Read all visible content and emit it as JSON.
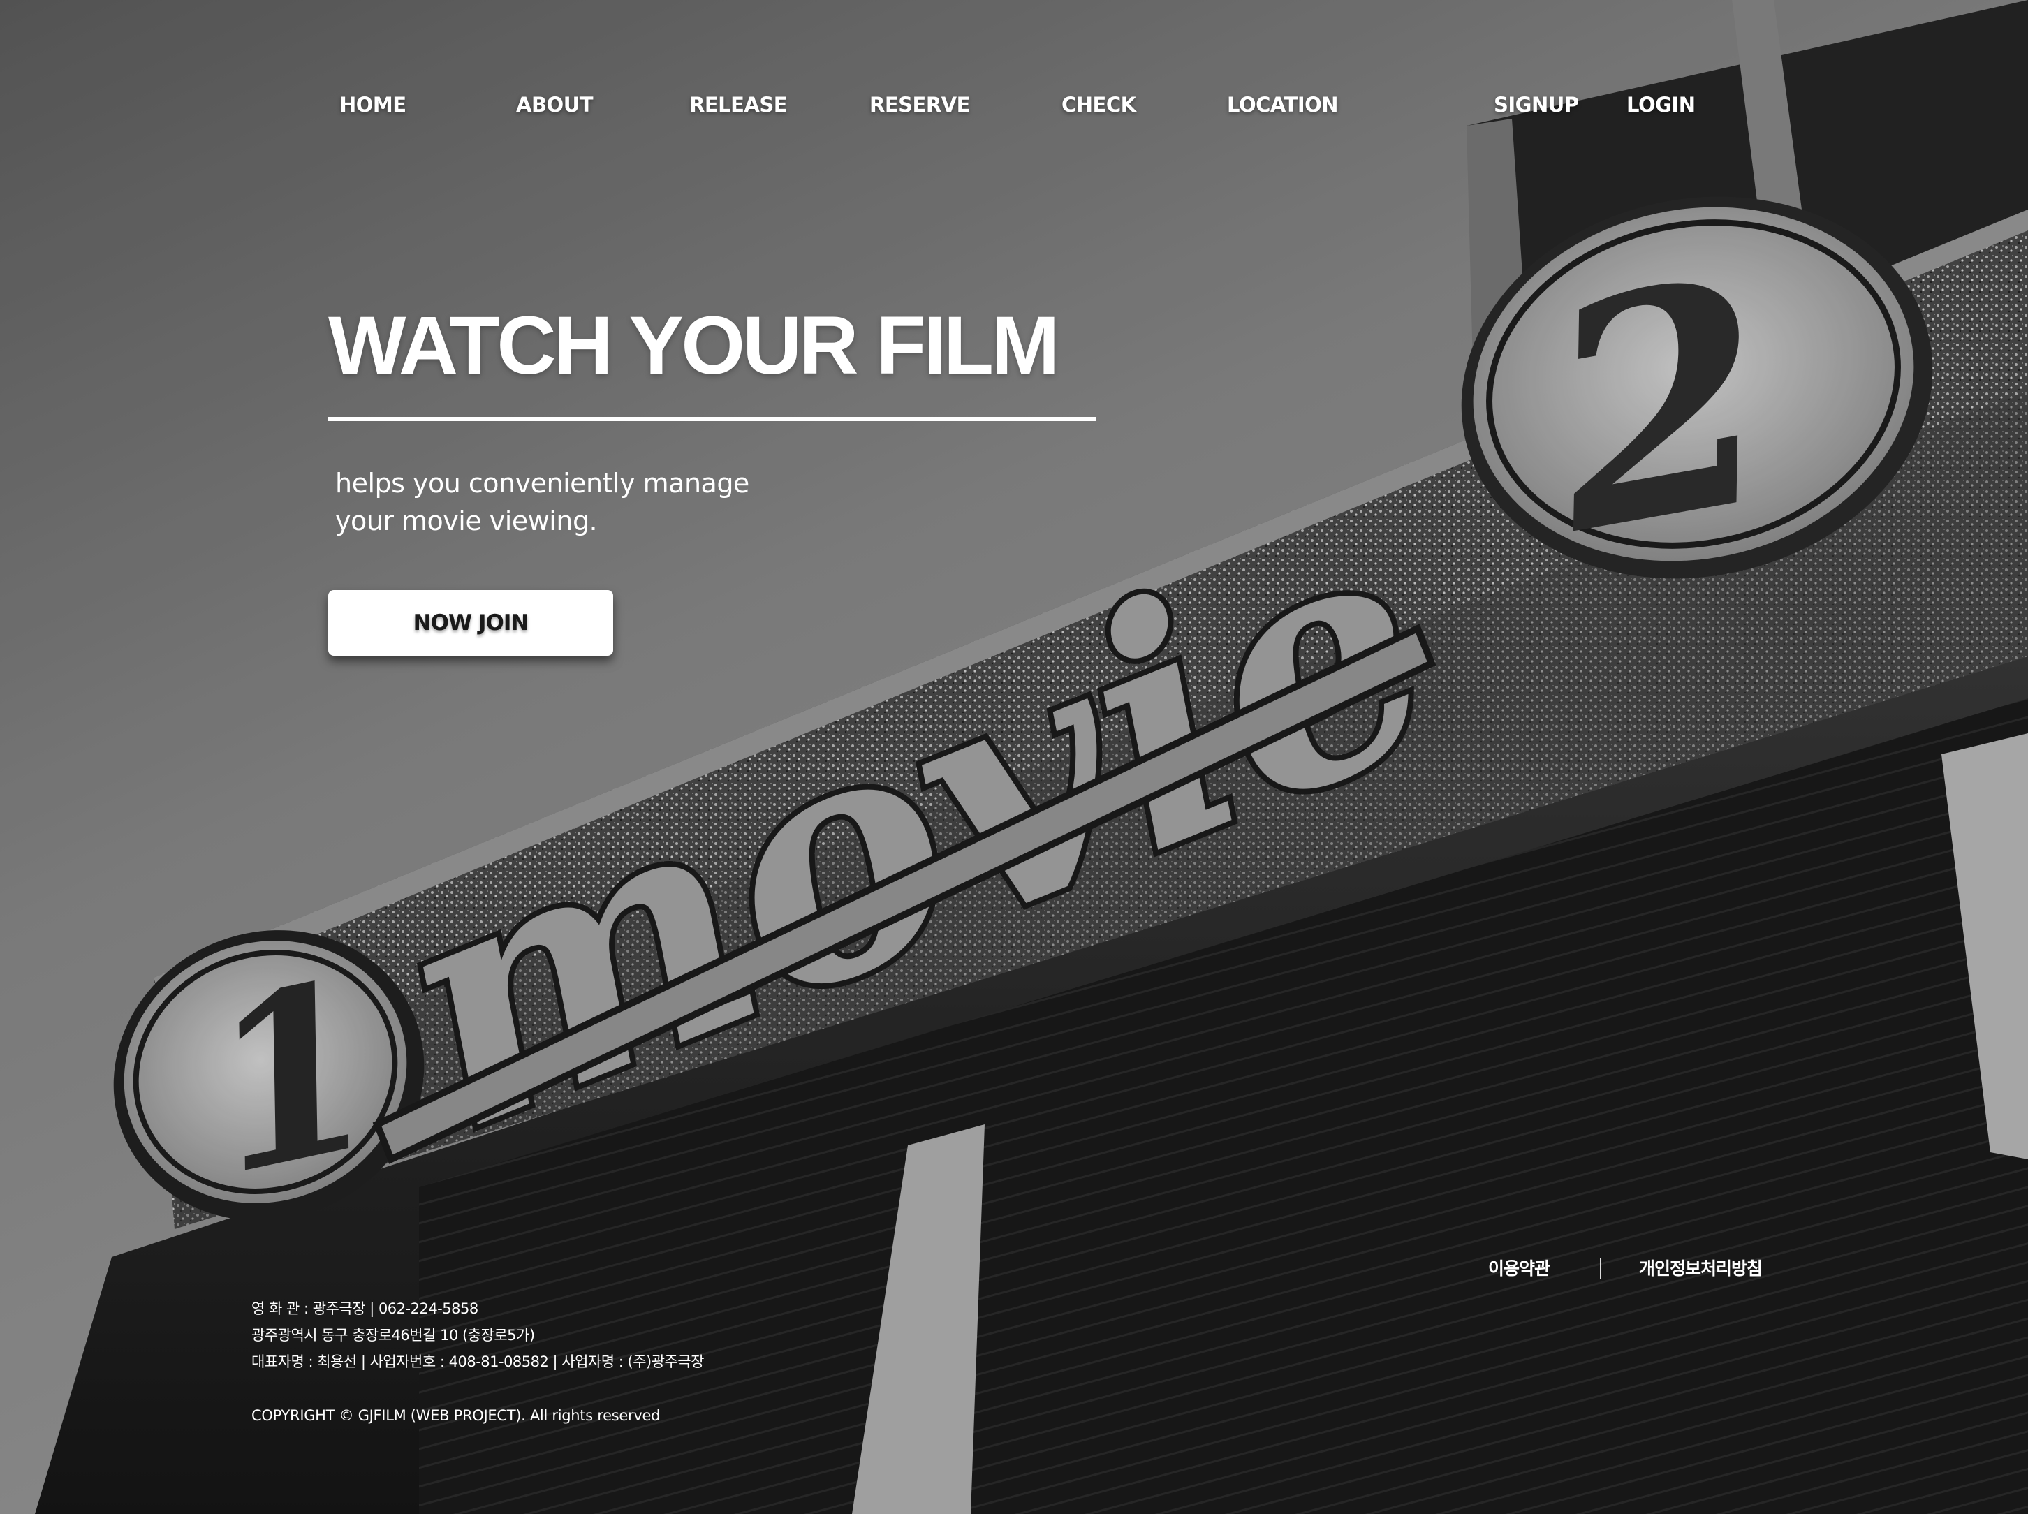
{
  "nav": {
    "items": [
      {
        "label": "HOME"
      },
      {
        "label": "ABOUT"
      },
      {
        "label": "RELEASE"
      },
      {
        "label": "RESERVE"
      },
      {
        "label": "CHECK"
      },
      {
        "label": "LOCATION"
      }
    ],
    "signup": "SIGNUP",
    "login": "LOGIN"
  },
  "hero": {
    "title": "WATCH YOUR FILM",
    "subtitle_line1": "helps you conveniently manage",
    "subtitle_line2": "your movie viewing.",
    "cta": "NOW JOIN"
  },
  "sign": {
    "left_number": "1",
    "word": "movie",
    "right_number": "2"
  },
  "footer": {
    "links": [
      "이용약관",
      "개인정보처리방침"
    ],
    "info": [
      "영 화 관 : 광주극장  |  062-224-5858",
      "광주광역시 동구 충장로46번길 10 (충장로5가)",
      "대표자명 : 최용선  |  사업자번호 : 408-81-08582  |  사업자명 : (주)광주극장"
    ],
    "copyright": "COPYRIGHT © GJFILM (WEB PROJECT). All rights reserved"
  },
  "theme": {
    "text": "#ffffff",
    "button_bg": "#ffffff",
    "button_text": "#1a1a1a"
  }
}
